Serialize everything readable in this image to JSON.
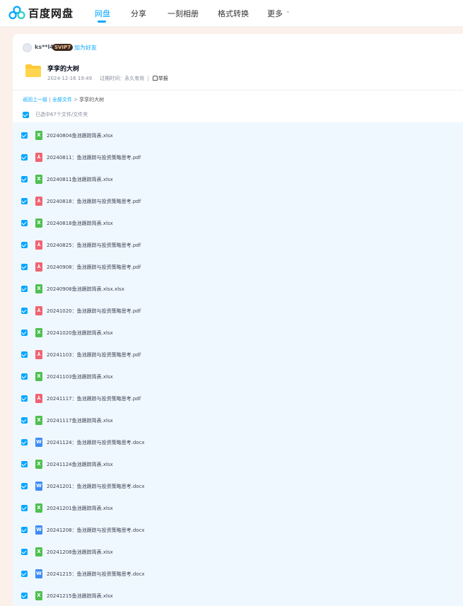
{
  "header": {
    "brand": "百度网盘",
    "nav": [
      {
        "label": "网盘",
        "active": true
      },
      {
        "label": "分享",
        "active": false
      },
      {
        "label": "一刻相册",
        "active": false
      },
      {
        "label": "格式转换",
        "active": false
      },
      {
        "label": "更多",
        "active": false
      }
    ],
    "more_chevron": "chevron-down-icon"
  },
  "share": {
    "user": "ks**l4",
    "vip_badge": "SVIP7",
    "add_friend": "加为好友",
    "folder_title": "孪孪的大树",
    "date": "2024-12-16 19:49",
    "expire_label": "过期时间：永久有效",
    "report": "举报"
  },
  "breadcrumb": {
    "back": "返回上一级",
    "all": "全部文件",
    "sep": ">",
    "current": "孪孪的大树",
    "divider": "|"
  },
  "selection": {
    "label": "已选中67个文件/文件夹",
    "checked": true
  },
  "files": [
    {
      "name": "20240804鱼池跟踪简表.xlsx",
      "type": "xlsx",
      "checked": true
    },
    {
      "name": "20240811：鱼池跟踪与投资策略思考.pdf",
      "type": "pdf",
      "checked": true
    },
    {
      "name": "20240811鱼池跟踪简表.xlsx",
      "type": "xlsx",
      "checked": true
    },
    {
      "name": "20240818：鱼池跟踪与投资策略思考.pdf",
      "type": "pdf",
      "checked": true
    },
    {
      "name": "20240818鱼池跟踪简表.xlsx",
      "type": "xlsx",
      "checked": true
    },
    {
      "name": "20240825：鱼池跟踪与投资策略思考.pdf",
      "type": "pdf",
      "checked": true
    },
    {
      "name": "20240908：鱼池跟踪与投资策略思考.pdf",
      "type": "pdf",
      "checked": true
    },
    {
      "name": "20240908鱼池跟踪简表.xlsx.xlsx",
      "type": "xlsx",
      "checked": true
    },
    {
      "name": "20241020：鱼池跟踪与投资策略思考.pdf",
      "type": "pdf",
      "checked": true
    },
    {
      "name": "20241020鱼池跟踪简表.xlsx",
      "type": "xlsx",
      "checked": true
    },
    {
      "name": "20241103：鱼池跟踪与投资策略思考.pdf",
      "type": "pdf",
      "checked": true
    },
    {
      "name": "20241103鱼池跟踪简表.xlsx",
      "type": "xlsx",
      "checked": true
    },
    {
      "name": "20241117：鱼池跟踪与投资策略思考.pdf",
      "type": "pdf",
      "checked": true
    },
    {
      "name": "20241117鱼池跟踪简表.xlsx",
      "type": "xlsx",
      "checked": true
    },
    {
      "name": "20241124：鱼池跟踪与投资策略思考.docx",
      "type": "docx",
      "checked": true
    },
    {
      "name": "20241124鱼池跟踪简表.xlsx",
      "type": "xlsx",
      "checked": true
    },
    {
      "name": "20241201：鱼池跟踪与投资策略思考.docx",
      "type": "docx",
      "checked": true
    },
    {
      "name": "20241201鱼池跟踪简表.xlsx",
      "type": "xlsx",
      "checked": true
    },
    {
      "name": "20241208：鱼池跟踪与投资策略思考.docx",
      "type": "docx",
      "checked": true
    },
    {
      "name": "20241208鱼池跟踪简表.xlsx",
      "type": "xlsx",
      "checked": true
    },
    {
      "name": "20241215：鱼池跟踪与投资策略思考.docx",
      "type": "docx",
      "checked": true
    },
    {
      "name": "20241215鱼池跟踪简表.xlsx",
      "type": "xlsx",
      "checked": true
    }
  ],
  "icon_glyphs": {
    "xlsx": "X",
    "pdf": "⅄",
    "docx": "W"
  },
  "colors": {
    "accent": "#06a7ff",
    "xlsx": "#4ec050",
    "pdf": "#f06373",
    "docx": "#3d8cf5",
    "page_bg": "#fbf1ea",
    "list_bg": "#f0f8ff"
  }
}
